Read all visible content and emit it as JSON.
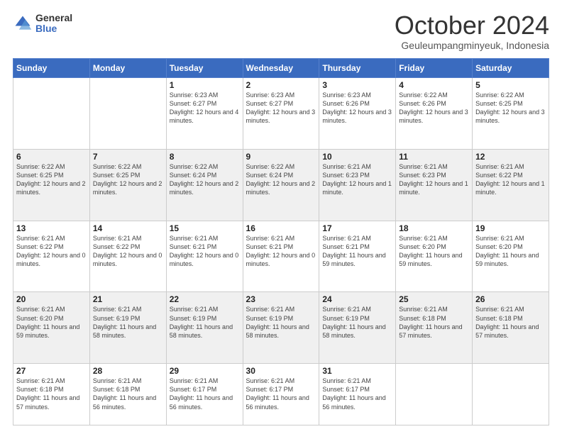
{
  "logo": {
    "general": "General",
    "blue": "Blue"
  },
  "header": {
    "month": "October 2024",
    "location": "Geuleumpangminyeuk, Indonesia"
  },
  "weekdays": [
    "Sunday",
    "Monday",
    "Tuesday",
    "Wednesday",
    "Thursday",
    "Friday",
    "Saturday"
  ],
  "weeks": [
    [
      {
        "day": "",
        "sunrise": "",
        "sunset": "",
        "daylight": ""
      },
      {
        "day": "",
        "sunrise": "",
        "sunset": "",
        "daylight": ""
      },
      {
        "day": "1",
        "sunrise": "Sunrise: 6:23 AM",
        "sunset": "Sunset: 6:27 PM",
        "daylight": "Daylight: 12 hours and 4 minutes."
      },
      {
        "day": "2",
        "sunrise": "Sunrise: 6:23 AM",
        "sunset": "Sunset: 6:27 PM",
        "daylight": "Daylight: 12 hours and 3 minutes."
      },
      {
        "day": "3",
        "sunrise": "Sunrise: 6:23 AM",
        "sunset": "Sunset: 6:26 PM",
        "daylight": "Daylight: 12 hours and 3 minutes."
      },
      {
        "day": "4",
        "sunrise": "Sunrise: 6:22 AM",
        "sunset": "Sunset: 6:26 PM",
        "daylight": "Daylight: 12 hours and 3 minutes."
      },
      {
        "day": "5",
        "sunrise": "Sunrise: 6:22 AM",
        "sunset": "Sunset: 6:25 PM",
        "daylight": "Daylight: 12 hours and 3 minutes."
      }
    ],
    [
      {
        "day": "6",
        "sunrise": "Sunrise: 6:22 AM",
        "sunset": "Sunset: 6:25 PM",
        "daylight": "Daylight: 12 hours and 2 minutes."
      },
      {
        "day": "7",
        "sunrise": "Sunrise: 6:22 AM",
        "sunset": "Sunset: 6:25 PM",
        "daylight": "Daylight: 12 hours and 2 minutes."
      },
      {
        "day": "8",
        "sunrise": "Sunrise: 6:22 AM",
        "sunset": "Sunset: 6:24 PM",
        "daylight": "Daylight: 12 hours and 2 minutes."
      },
      {
        "day": "9",
        "sunrise": "Sunrise: 6:22 AM",
        "sunset": "Sunset: 6:24 PM",
        "daylight": "Daylight: 12 hours and 2 minutes."
      },
      {
        "day": "10",
        "sunrise": "Sunrise: 6:21 AM",
        "sunset": "Sunset: 6:23 PM",
        "daylight": "Daylight: 12 hours and 1 minute."
      },
      {
        "day": "11",
        "sunrise": "Sunrise: 6:21 AM",
        "sunset": "Sunset: 6:23 PM",
        "daylight": "Daylight: 12 hours and 1 minute."
      },
      {
        "day": "12",
        "sunrise": "Sunrise: 6:21 AM",
        "sunset": "Sunset: 6:22 PM",
        "daylight": "Daylight: 12 hours and 1 minute."
      }
    ],
    [
      {
        "day": "13",
        "sunrise": "Sunrise: 6:21 AM",
        "sunset": "Sunset: 6:22 PM",
        "daylight": "Daylight: 12 hours and 0 minutes."
      },
      {
        "day": "14",
        "sunrise": "Sunrise: 6:21 AM",
        "sunset": "Sunset: 6:22 PM",
        "daylight": "Daylight: 12 hours and 0 minutes."
      },
      {
        "day": "15",
        "sunrise": "Sunrise: 6:21 AM",
        "sunset": "Sunset: 6:21 PM",
        "daylight": "Daylight: 12 hours and 0 minutes."
      },
      {
        "day": "16",
        "sunrise": "Sunrise: 6:21 AM",
        "sunset": "Sunset: 6:21 PM",
        "daylight": "Daylight: 12 hours and 0 minutes."
      },
      {
        "day": "17",
        "sunrise": "Sunrise: 6:21 AM",
        "sunset": "Sunset: 6:21 PM",
        "daylight": "Daylight: 11 hours and 59 minutes."
      },
      {
        "day": "18",
        "sunrise": "Sunrise: 6:21 AM",
        "sunset": "Sunset: 6:20 PM",
        "daylight": "Daylight: 11 hours and 59 minutes."
      },
      {
        "day": "19",
        "sunrise": "Sunrise: 6:21 AM",
        "sunset": "Sunset: 6:20 PM",
        "daylight": "Daylight: 11 hours and 59 minutes."
      }
    ],
    [
      {
        "day": "20",
        "sunrise": "Sunrise: 6:21 AM",
        "sunset": "Sunset: 6:20 PM",
        "daylight": "Daylight: 11 hours and 59 minutes."
      },
      {
        "day": "21",
        "sunrise": "Sunrise: 6:21 AM",
        "sunset": "Sunset: 6:19 PM",
        "daylight": "Daylight: 11 hours and 58 minutes."
      },
      {
        "day": "22",
        "sunrise": "Sunrise: 6:21 AM",
        "sunset": "Sunset: 6:19 PM",
        "daylight": "Daylight: 11 hours and 58 minutes."
      },
      {
        "day": "23",
        "sunrise": "Sunrise: 6:21 AM",
        "sunset": "Sunset: 6:19 PM",
        "daylight": "Daylight: 11 hours and 58 minutes."
      },
      {
        "day": "24",
        "sunrise": "Sunrise: 6:21 AM",
        "sunset": "Sunset: 6:19 PM",
        "daylight": "Daylight: 11 hours and 58 minutes."
      },
      {
        "day": "25",
        "sunrise": "Sunrise: 6:21 AM",
        "sunset": "Sunset: 6:18 PM",
        "daylight": "Daylight: 11 hours and 57 minutes."
      },
      {
        "day": "26",
        "sunrise": "Sunrise: 6:21 AM",
        "sunset": "Sunset: 6:18 PM",
        "daylight": "Daylight: 11 hours and 57 minutes."
      }
    ],
    [
      {
        "day": "27",
        "sunrise": "Sunrise: 6:21 AM",
        "sunset": "Sunset: 6:18 PM",
        "daylight": "Daylight: 11 hours and 57 minutes."
      },
      {
        "day": "28",
        "sunrise": "Sunrise: 6:21 AM",
        "sunset": "Sunset: 6:18 PM",
        "daylight": "Daylight: 11 hours and 56 minutes."
      },
      {
        "day": "29",
        "sunrise": "Sunrise: 6:21 AM",
        "sunset": "Sunset: 6:17 PM",
        "daylight": "Daylight: 11 hours and 56 minutes."
      },
      {
        "day": "30",
        "sunrise": "Sunrise: 6:21 AM",
        "sunset": "Sunset: 6:17 PM",
        "daylight": "Daylight: 11 hours and 56 minutes."
      },
      {
        "day": "31",
        "sunrise": "Sunrise: 6:21 AM",
        "sunset": "Sunset: 6:17 PM",
        "daylight": "Daylight: 11 hours and 56 minutes."
      },
      {
        "day": "",
        "sunrise": "",
        "sunset": "",
        "daylight": ""
      },
      {
        "day": "",
        "sunrise": "",
        "sunset": "",
        "daylight": ""
      }
    ]
  ]
}
